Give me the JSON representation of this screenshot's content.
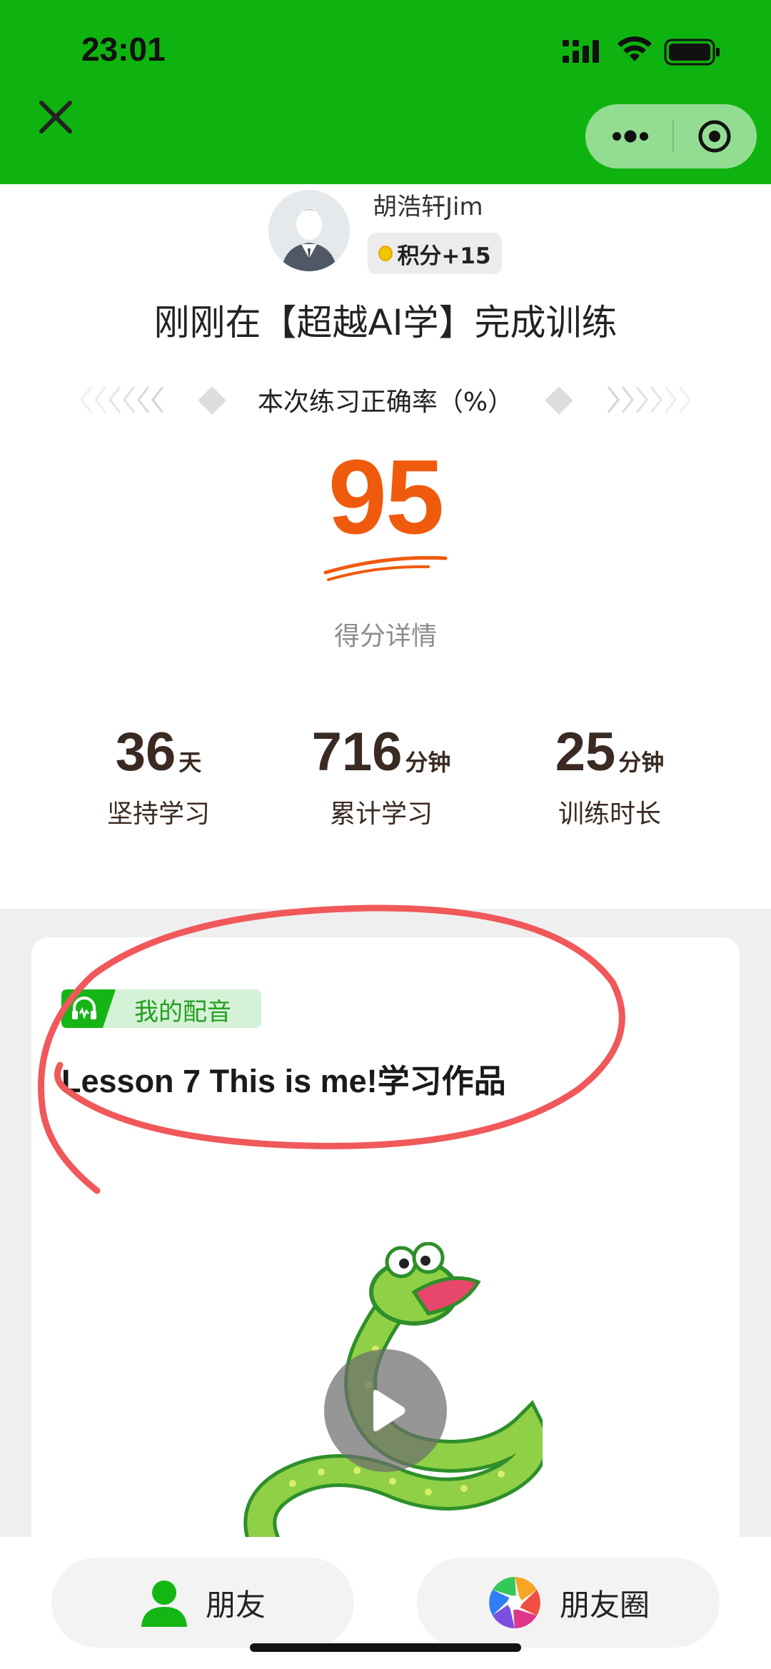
{
  "status_bar": {
    "time": "23:01"
  },
  "nav": {
    "close_icon": "close-icon",
    "more_icon": "more-icon",
    "target_icon": "target-icon",
    "brand_color": "#0fb30f"
  },
  "profile": {
    "username": "胡浩轩Jim",
    "points_badge": "积分+15"
  },
  "result": {
    "headline": "刚刚在【超越AI学】完成训练",
    "accuracy_label": "本次练习正确率（%）",
    "score": "95",
    "score_color": "#f05a0c",
    "detail_link": "得分详情"
  },
  "stats": [
    {
      "value": "36",
      "unit": "天",
      "label": "坚持学习"
    },
    {
      "value": "716",
      "unit": "分钟",
      "label": "累计学习"
    },
    {
      "value": "25",
      "unit": "分钟",
      "label": "训练时长"
    }
  ],
  "work": {
    "tag": "我的配音",
    "title": "Lesson 7 This is me!学习作品"
  },
  "share": {
    "friend_label": "朋友",
    "moments_label": "朋友圈"
  }
}
